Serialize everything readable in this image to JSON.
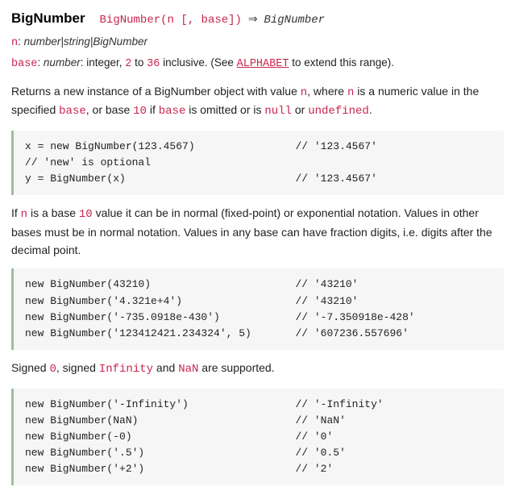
{
  "header": {
    "title": "BigNumber",
    "signature": "BigNumber(n [, base])",
    "arrow": "⇒",
    "returns": "BigNumber"
  },
  "params": {
    "n": {
      "name": "n",
      "type": "number|string|BigNumber"
    },
    "base": {
      "name": "base",
      "type": "number",
      "tail1": ": integer, ",
      "lo": "2",
      "mid": " to ",
      "hi": "36",
      "tail2": " inclusive. (See ",
      "link": "ALPHABET",
      "tail3": " to extend this range)."
    }
  },
  "desc1": {
    "t1": "Returns a new instance of a BigNumber object with value ",
    "n": "n",
    "t2": ", where ",
    "n2": "n",
    "t3": " is a numeric value in the specified ",
    "base": "base",
    "t4": ", or base ",
    "ten": "10",
    "t5": " if ",
    "base2": "base",
    "t6": " is omitted or is ",
    "null": "null",
    "t7": " or ",
    "undef": "undefined",
    "t8": "."
  },
  "code1": "x = new BigNumber(123.4567)                // '123.4567'\n// 'new' is optional\ny = BigNumber(x)                           // '123.4567'",
  "desc2": {
    "t1": "If ",
    "n": "n",
    "t2": " is a base ",
    "ten": "10",
    "t3": " value it can be in normal (fixed-point) or exponential notation. Values in other bases must be in normal notation. Values in any base can have fraction digits, i.e. digits after the decimal point."
  },
  "code2": "new BigNumber(43210)                       // '43210'\nnew BigNumber('4.321e+4')                  // '43210'\nnew BigNumber('-735.0918e-430')            // '-7.350918e-428'\nnew BigNumber('123412421.234324', 5)       // '607236.557696'",
  "desc3": {
    "t1": "Signed ",
    "zero": "0",
    "t2": ", signed ",
    "inf": "Infinity",
    "t3": " and ",
    "nan": "NaN",
    "t4": " are supported."
  },
  "code3": "new BigNumber('-Infinity')                 // '-Infinity'\nnew BigNumber(NaN)                         // 'NaN'\nnew BigNumber(-0)                          // '0'\nnew BigNumber('.5')                        // '0.5'\nnew BigNumber('+2')                        // '2'"
}
